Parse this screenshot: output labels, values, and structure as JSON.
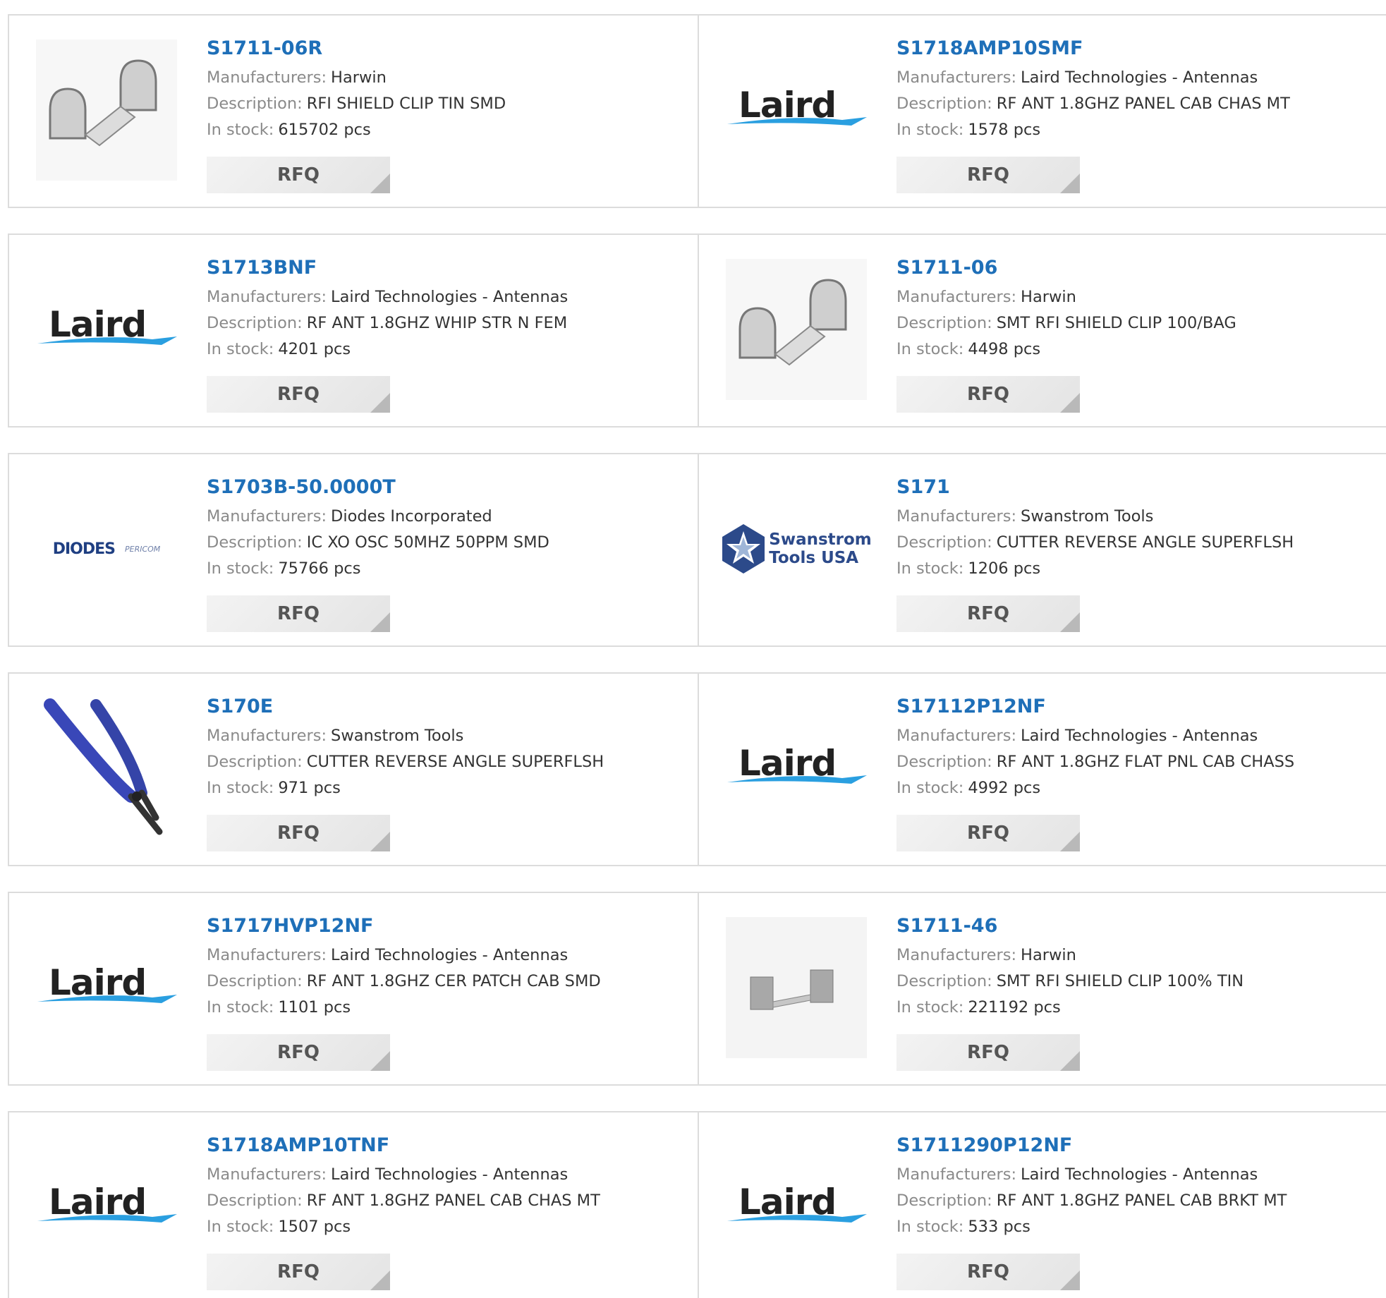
{
  "labels": {
    "manufacturers": "Manufacturers:",
    "description": "Description:",
    "in_stock": "In stock:",
    "rfq": "RFQ"
  },
  "products": [
    {
      "part": "S1711-06R",
      "manufacturer": "Harwin",
      "description": "RFI SHIELD CLIP TIN SMD",
      "stock": "615702 pcs",
      "image": "shield-clip"
    },
    {
      "part": "S1718AMP10SMF",
      "manufacturer": "Laird Technologies - Antennas",
      "description": "RF ANT 1.8GHZ PANEL CAB CHAS MT",
      "stock": "1578 pcs",
      "image": "laird-logo"
    },
    {
      "part": "S1713BNF",
      "manufacturer": "Laird Technologies - Antennas",
      "description": "RF ANT 1.8GHZ WHIP STR N FEM",
      "stock": "4201 pcs",
      "image": "laird-logo"
    },
    {
      "part": "S1711-06",
      "manufacturer": "Harwin",
      "description": "SMT RFI SHIELD CLIP 100/BAG",
      "stock": "4498 pcs",
      "image": "shield-clip"
    },
    {
      "part": "S1703B-50.0000T",
      "manufacturer": "Diodes Incorporated",
      "description": "IC XO OSC 50MHZ 50PPM SMD",
      "stock": "75766 pcs",
      "image": "diodes-logo"
    },
    {
      "part": "S171",
      "manufacturer": "Swanstrom Tools",
      "description": "CUTTER REVERSE ANGLE SUPERFLSH",
      "stock": "1206 pcs",
      "image": "swanstrom-logo"
    },
    {
      "part": "S170E",
      "manufacturer": "Swanstrom Tools",
      "description": "CUTTER REVERSE ANGLE SUPERFLSH",
      "stock": "971 pcs",
      "image": "cutter"
    },
    {
      "part": "S17112P12NF",
      "manufacturer": "Laird Technologies - Antennas",
      "description": "RF ANT 1.8GHZ FLAT PNL CAB CHASS",
      "stock": "4992 pcs",
      "image": "laird-logo"
    },
    {
      "part": "S1717HVP12NF",
      "manufacturer": "Laird Technologies - Antennas",
      "description": "RF ANT 1.8GHZ CER PATCH CAB SMD",
      "stock": "1101 pcs",
      "image": "laird-logo"
    },
    {
      "part": "S1711-46",
      "manufacturer": "Harwin",
      "description": "SMT RFI SHIELD CLIP 100% TIN",
      "stock": "221192 pcs",
      "image": "shield-clip-small"
    },
    {
      "part": "S1718AMP10TNF",
      "manufacturer": "Laird Technologies - Antennas",
      "description": "RF ANT 1.8GHZ PANEL CAB CHAS MT",
      "stock": "1507 pcs",
      "image": "laird-logo"
    },
    {
      "part": "S1711290P12NF",
      "manufacturer": "Laird Technologies - Antennas",
      "description": "RF ANT 1.8GHZ PANEL CAB BRKT MT",
      "stock": "533 pcs",
      "image": "laird-logo"
    }
  ],
  "logos": {
    "laird": "Laird",
    "diodes_main": "DIODES",
    "diodes_sub": "PERICOM",
    "swanstrom_line1": "Swanstrom",
    "swanstrom_line2": "Tools USA"
  },
  "colors": {
    "part_link": "#1e6fb8",
    "label": "#8a8a8a",
    "border": "#dcdcdc",
    "rfq_bg": "#ececec"
  }
}
